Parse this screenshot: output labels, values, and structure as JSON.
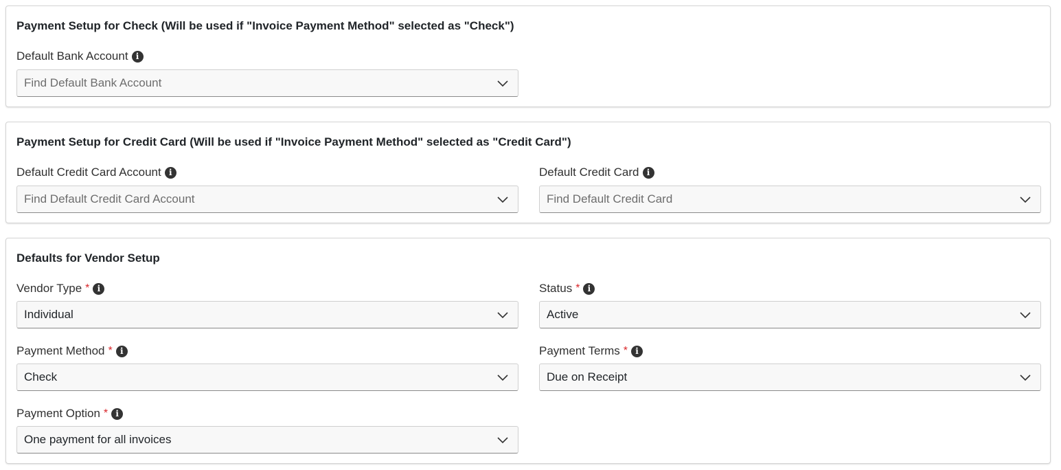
{
  "check_section": {
    "title": "Payment Setup for Check (Will be used if \"Invoice Payment Method\" selected as \"Check\")",
    "bank_account": {
      "label": "Default Bank Account",
      "placeholder": "Find Default Bank Account",
      "icon": "info-icon"
    }
  },
  "credit_card_section": {
    "title": "Payment Setup for Credit Card (Will be used if \"Invoice Payment Method\" selected as \"Credit Card\")",
    "credit_card_account": {
      "label": "Default Credit Card Account",
      "placeholder": "Find Default Credit Card Account",
      "icon": "info-icon"
    },
    "credit_card": {
      "label": "Default Credit Card",
      "placeholder": "Find Default Credit Card",
      "icon": "info-icon"
    }
  },
  "vendor_section": {
    "title": "Defaults for Vendor Setup",
    "required_marker": "*",
    "vendor_type": {
      "label": "Vendor Type",
      "value": "Individual"
    },
    "status": {
      "label": "Status",
      "value": "Active"
    },
    "payment_method": {
      "label": "Payment Method",
      "value": "Check"
    },
    "payment_terms": {
      "label": "Payment Terms",
      "value": "Due on Receipt"
    },
    "payment_option": {
      "label": "Payment Option",
      "value": "One payment for all invoices"
    }
  },
  "colors": {
    "required": "#d9262a",
    "info_icon": "#333333",
    "placeholder_text": "#6d6d6d",
    "select_background": "#f8f8f8"
  }
}
